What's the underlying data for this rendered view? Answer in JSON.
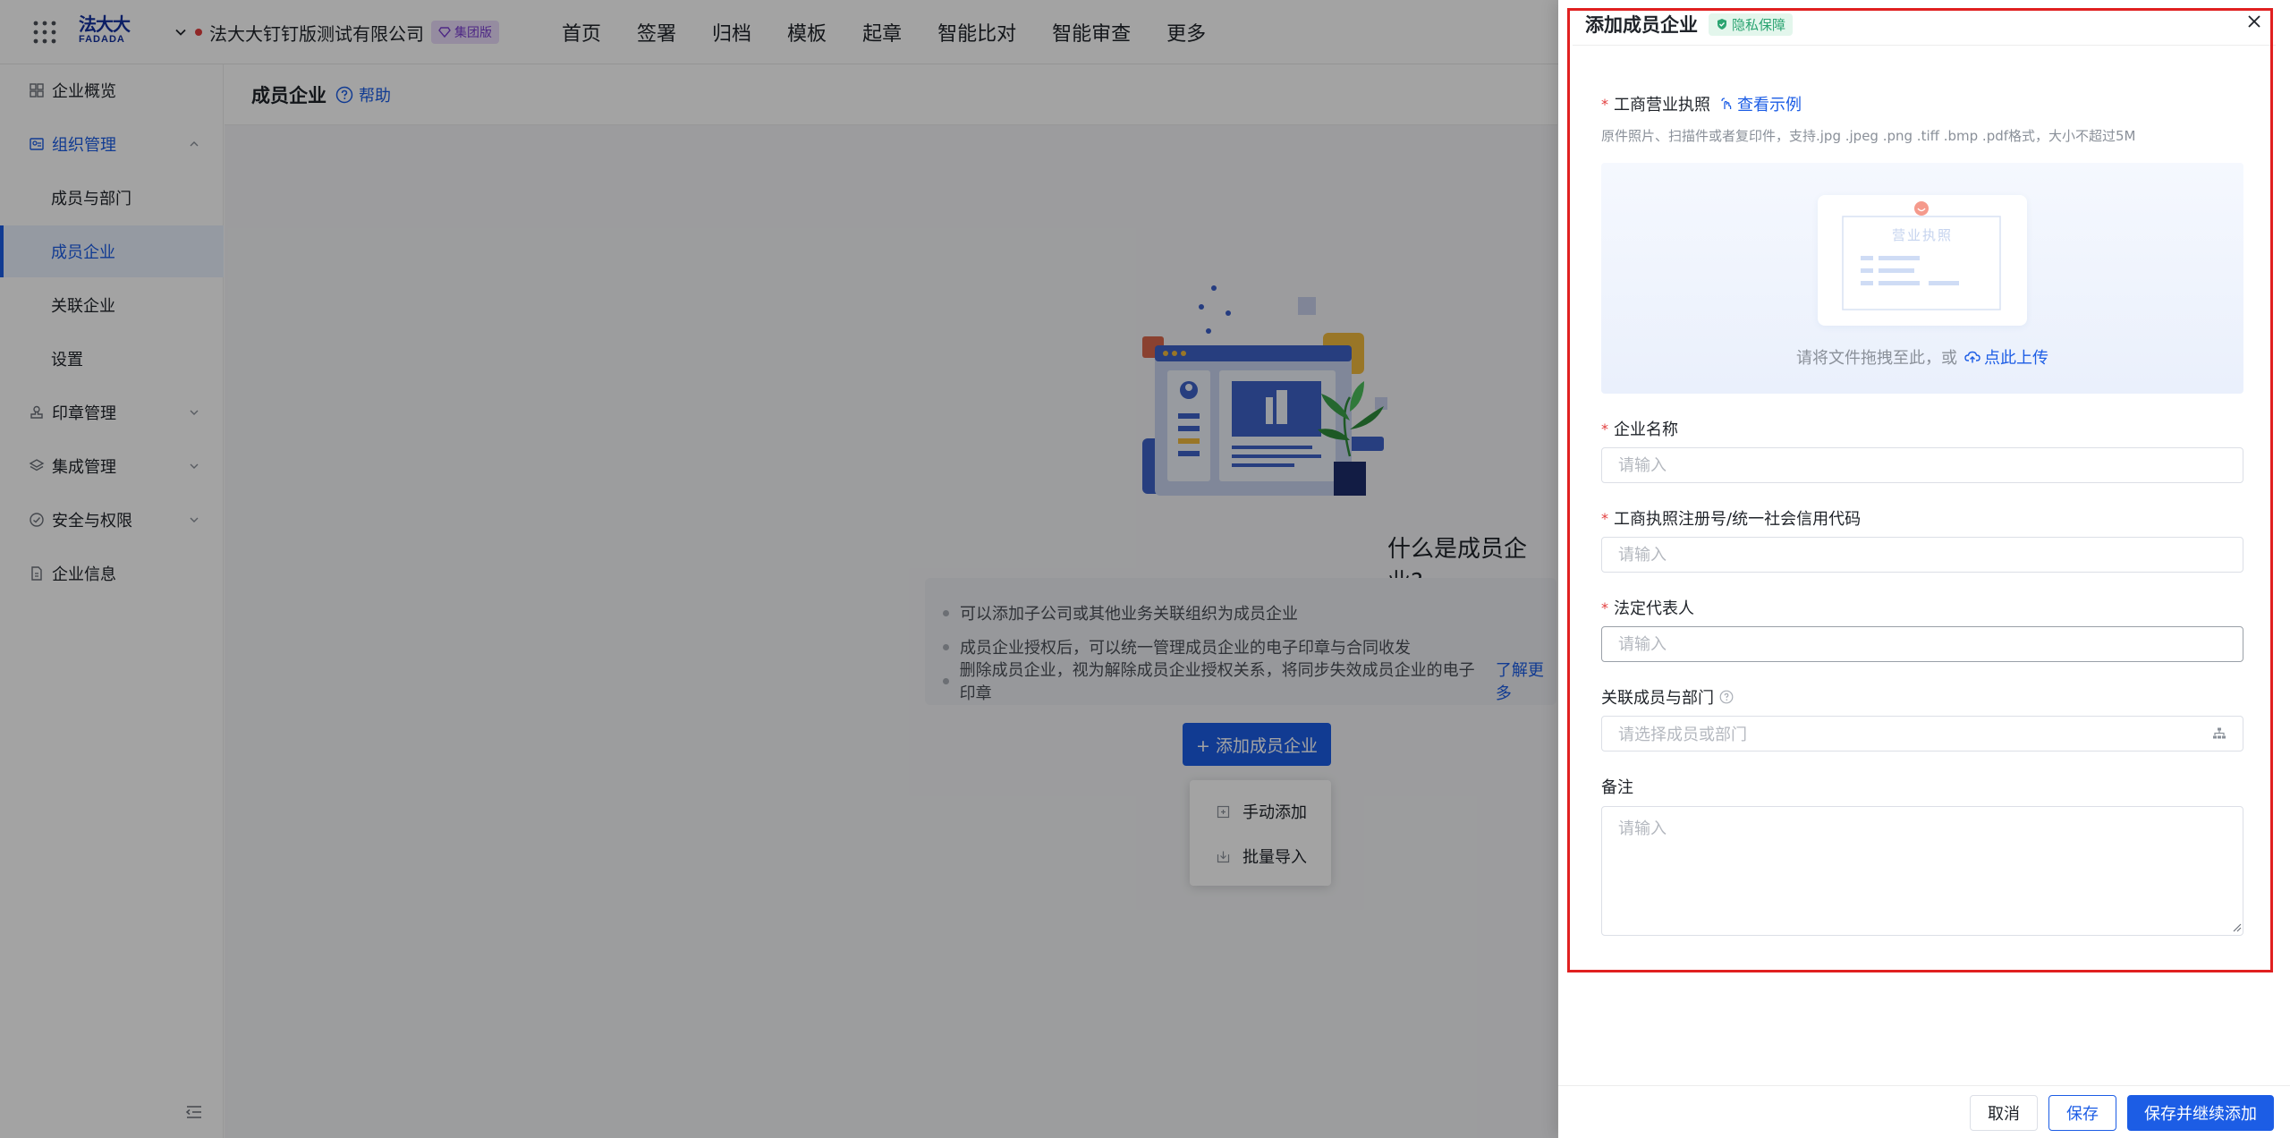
{
  "header": {
    "logo_cn": "法大大",
    "logo_en": "FADADA",
    "company": "法大大钉钉版测试有限公司",
    "edition_badge": "集团版",
    "nav": [
      "首页",
      "签署",
      "归档",
      "模板",
      "起章",
      "智能比对",
      "智能审查",
      "更多"
    ]
  },
  "sidebar": {
    "items": [
      {
        "label": "企业概览"
      },
      {
        "label": "组织管理"
      },
      {
        "label": "成员与部门"
      },
      {
        "label": "成员企业"
      },
      {
        "label": "关联企业"
      },
      {
        "label": "设置"
      },
      {
        "label": "印章管理"
      },
      {
        "label": "集成管理"
      },
      {
        "label": "安全与权限"
      },
      {
        "label": "企业信息"
      }
    ]
  },
  "main": {
    "page_title": "成员企业",
    "help_label": "帮助",
    "empty_title": "什么是成员企业?",
    "info_lines": [
      "可以添加子公司或其他业务关联组织为成员企业",
      "成员企业授权后，可以统一管理成员企业的电子印章与合同收发",
      "删除成员企业，视为解除成员企业授权关系，将同步失效成员企业的电子印章"
    ],
    "learn_more": "了解更多",
    "add_button": "+ 添加成员企业",
    "dropdown": [
      "手动添加",
      "批量导入"
    ]
  },
  "drawer": {
    "title": "添加成员企业",
    "privacy_badge": "隐私保障",
    "license_label": "工商营业执照",
    "view_example": "查看示例",
    "license_hint": "原件照片、扫描件或者复印件，支持.jpg .jpeg .png .tiff .bmp .pdf格式，大小不超过5M",
    "license_card_title": "营业执照",
    "upload_text": "请将文件拖拽至此，或",
    "upload_link": "点此上传",
    "fields": {
      "company_name": {
        "label": "企业名称",
        "placeholder": "请输入"
      },
      "credit_code": {
        "label": "工商执照注册号/统一社会信用代码",
        "placeholder": "请输入"
      },
      "legal_rep": {
        "label": "法定代表人",
        "placeholder": "请输入"
      },
      "members": {
        "label": "关联成员与部门",
        "placeholder": "请选择成员或部门"
      },
      "remark": {
        "label": "备注",
        "placeholder": "请输入"
      }
    },
    "buttons": {
      "cancel": "取消",
      "save": "保存",
      "save_continue": "保存并继续添加"
    }
  },
  "colors": {
    "primary": "#1c5de5",
    "required": "#e23d3d",
    "highlight": "#e02020",
    "privacy": "#2ba471"
  }
}
